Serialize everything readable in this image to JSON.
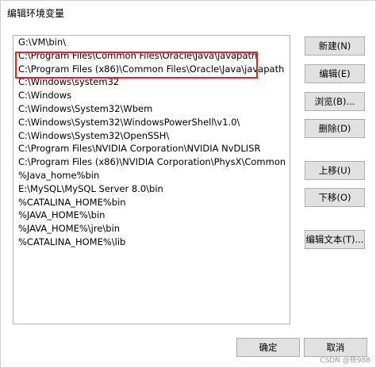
{
  "window": {
    "title": "编辑环境变量"
  },
  "paths": [
    "G:\\VM\\bin\\",
    "C:\\Program Files\\Common Files\\Oracle\\Java\\javapath",
    "C:\\Program Files (x86)\\Common Files\\Oracle\\Java\\javapath",
    "C:\\Windows\\system32",
    "C:\\Windows",
    "C:\\Windows\\System32\\Wbem",
    "C:\\Windows\\System32\\WindowsPowerShell\\v1.0\\",
    "C:\\Windows\\System32\\OpenSSH\\",
    "C:\\Program Files\\NVIDIA Corporation\\NVIDIA NvDLISR",
    "C:\\Program Files (x86)\\NVIDIA Corporation\\PhysX\\Common",
    "%Java_home%bin",
    "E:\\MySQL\\MySQL Server 8.0\\bin",
    "%CATALINA_HOME%bin",
    "%JAVA_HOME%\\bin",
    "%JAVA_HOME%\\jre\\bin",
    "%CATALINA_HOME%\\lib"
  ],
  "buttons": {
    "new": "新建(N)",
    "edit": "编辑(E)",
    "browse": "浏览(B)...",
    "delete": "删除(D)",
    "move_up": "上移(U)",
    "move_down": "下移(O)",
    "edit_text": "编辑文本(T)...",
    "ok": "确定",
    "cancel": "取消"
  },
  "watermark": "CSDN @轶988",
  "colors": {
    "highlight": "#e0282a"
  }
}
